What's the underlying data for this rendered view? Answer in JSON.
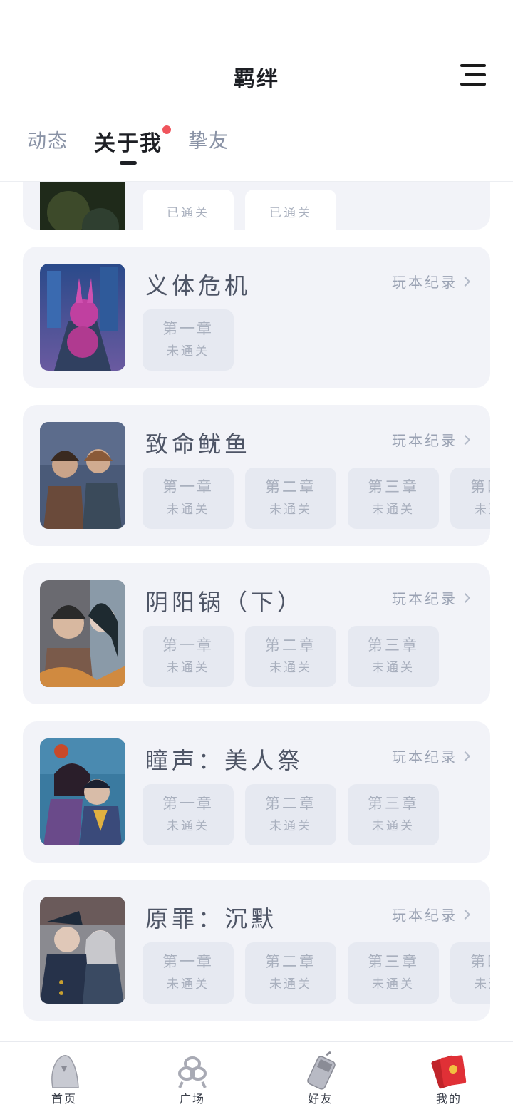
{
  "header": {
    "title": "羁绊",
    "menu_icon": "hamburger-menu-icon",
    "tabs": [
      {
        "label": "动态",
        "active": false
      },
      {
        "label": "关于我",
        "active": true,
        "badge": "red-dot"
      },
      {
        "label": "挚友",
        "active": false
      }
    ]
  },
  "games": [
    {
      "title": "",
      "record_label": "",
      "chapters": [
        {
          "name": "",
          "status": "已通关"
        },
        {
          "name": "",
          "status": "已通关"
        }
      ]
    },
    {
      "title": "义体危机",
      "record_label": "玩本纪录",
      "chapters": [
        {
          "name": "第一章",
          "status": "未通关"
        }
      ]
    },
    {
      "title": "致命鱿鱼",
      "record_label": "玩本纪录",
      "chapters": [
        {
          "name": "第一章",
          "status": "未通关"
        },
        {
          "name": "第二章",
          "status": "未通关"
        },
        {
          "name": "第三章",
          "status": "未通关"
        },
        {
          "name": "第四章",
          "status": "未通关"
        }
      ]
    },
    {
      "title": "阴阳锅（下）",
      "record_label": "玩本纪录",
      "chapters": [
        {
          "name": "第一章",
          "status": "未通关"
        },
        {
          "name": "第二章",
          "status": "未通关"
        },
        {
          "name": "第三章",
          "status": "未通关"
        }
      ]
    },
    {
      "title": "瞳声：美人祭",
      "record_label": "玩本纪录",
      "chapters": [
        {
          "name": "第一章",
          "status": "未通关"
        },
        {
          "name": "第二章",
          "status": "未通关"
        },
        {
          "name": "第三章",
          "status": "未通关"
        }
      ]
    },
    {
      "title": "原罪：沉默",
      "record_label": "玩本纪录",
      "chapters": [
        {
          "name": "第一章",
          "status": "未通关"
        },
        {
          "name": "第二章",
          "status": "未通关"
        },
        {
          "name": "第三章",
          "status": "未通关"
        },
        {
          "name": "第四章",
          "status": "未通关"
        }
      ]
    }
  ],
  "bottom_nav": [
    {
      "label": "首页",
      "icon": "ghost-icon"
    },
    {
      "label": "广场",
      "icon": "knot-icon"
    },
    {
      "label": "好友",
      "icon": "phone-icon"
    },
    {
      "label": "我的",
      "icon": "red-envelope-icon",
      "active": true
    }
  ],
  "colors": {
    "card_bg": "#f2f3f8",
    "chapter_bg": "#e6e9f1",
    "badge": "#f0545c",
    "text_muted": "#a9b0be"
  }
}
